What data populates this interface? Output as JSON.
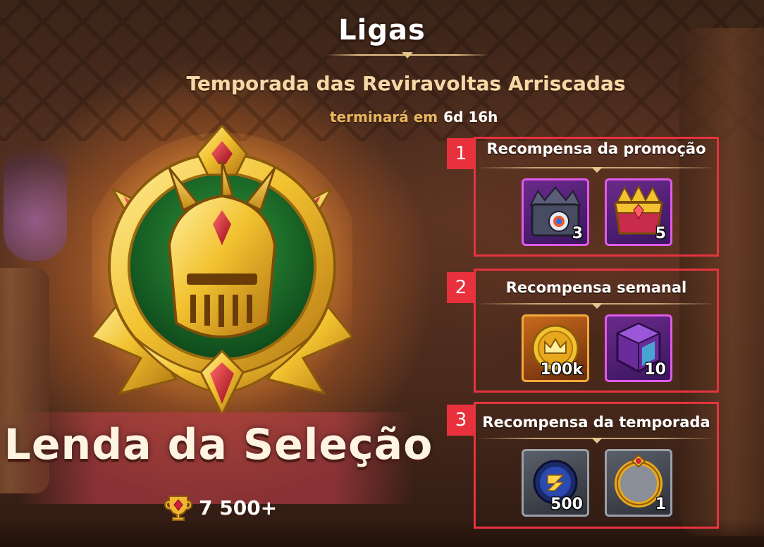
{
  "header": {
    "title": "Ligas",
    "season_name": "Temporada das Reviravoltas Arriscadas",
    "ends_label": "terminará em",
    "ends_value": "6d 16h"
  },
  "league": {
    "name": "Lenda da Seleção",
    "trophies": "7 500+"
  },
  "rewards": [
    {
      "number": "1",
      "title": "Recompensa da promoção",
      "items": [
        {
          "icon": "spiked-vault-chest-icon",
          "quantity": "3",
          "frame": "purple"
        },
        {
          "icon": "royal-crown-chest-icon",
          "quantity": "5",
          "frame": "purple"
        }
      ]
    },
    {
      "number": "2",
      "title": "Recompensa semanal",
      "items": [
        {
          "icon": "gold-crown-coin-icon",
          "quantity": "100k",
          "frame": "gold"
        },
        {
          "icon": "magic-cube-icon",
          "quantity": "10",
          "frame": "purple"
        }
      ]
    },
    {
      "number": "3",
      "title": "Recompensa da temporada",
      "items": [
        {
          "icon": "blue-rune-orb-icon",
          "quantity": "500",
          "frame": "grey"
        },
        {
          "icon": "gold-avatar-frame-icon",
          "quantity": "1",
          "frame": "grey"
        }
      ]
    }
  ],
  "colors": {
    "highlight_border": "#e7333f",
    "title_text": "#ffffff",
    "season_text": "#f6d9a6",
    "ends_label": "#e7b85f"
  }
}
